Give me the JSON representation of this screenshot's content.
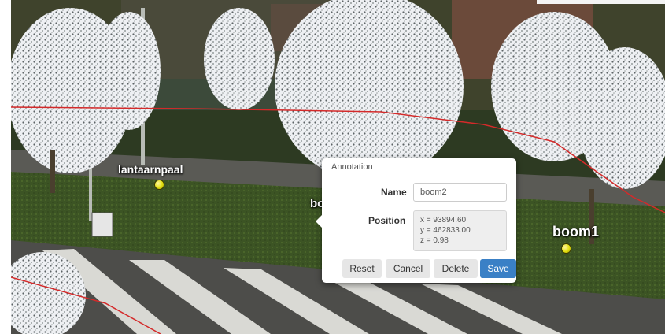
{
  "scene": {
    "labels": [
      {
        "text": "lantaarnpaal"
      },
      {
        "text": "boo"
      },
      {
        "text": "boom1"
      }
    ]
  },
  "dialog": {
    "title": "Annotation",
    "name_label": "Name",
    "name_value": "boom2",
    "position_label": "Position",
    "position": {
      "x": "x = 93894.60",
      "y": "y = 462833.00",
      "z": "z = 0.98"
    },
    "buttons": {
      "reset": "Reset",
      "cancel": "Cancel",
      "delete": "Delete",
      "save": "Save"
    }
  },
  "colors": {
    "save_button": "#3a80c6",
    "boundary_line": "#d42a2a",
    "marker": "#e3df10"
  }
}
